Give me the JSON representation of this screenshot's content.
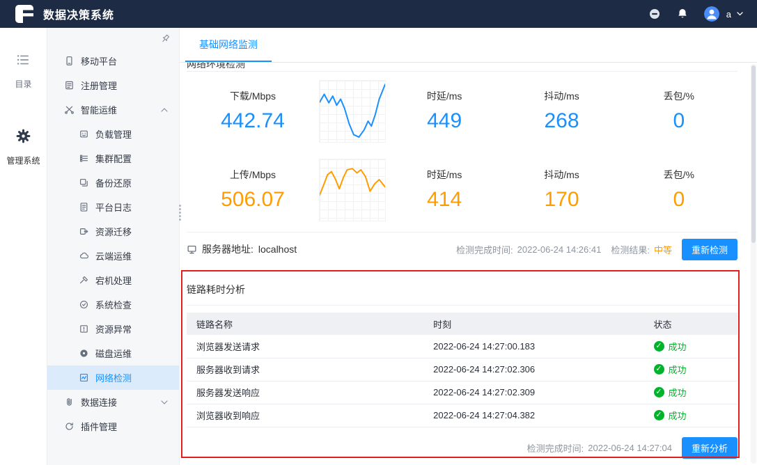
{
  "topbar": {
    "title": "数据决策系统",
    "username": "a"
  },
  "rail": {
    "catalog_label": "目录",
    "admin_label": "管理系统"
  },
  "sidebar": {
    "items": [
      {
        "label": "移动平台"
      },
      {
        "label": "注册管理"
      },
      {
        "label": "智能运维"
      },
      {
        "label": "负载管理"
      },
      {
        "label": "集群配置"
      },
      {
        "label": "备份还原"
      },
      {
        "label": "平台日志"
      },
      {
        "label": "资源迁移"
      },
      {
        "label": "云端运维"
      },
      {
        "label": "宕机处理"
      },
      {
        "label": "系统检查"
      },
      {
        "label": "资源异常"
      },
      {
        "label": "磁盘运维"
      },
      {
        "label": "网络检测"
      },
      {
        "label": "数据连接"
      },
      {
        "label": "插件管理"
      }
    ]
  },
  "tab": {
    "label": "基础网络监测"
  },
  "network": {
    "section_title": "网络环境检测",
    "download": {
      "label": "下载/Mbps",
      "value": "442.74",
      "delay_label": "时延/ms",
      "delay": "449",
      "jitter_label": "抖动/ms",
      "jitter": "268",
      "loss_label": "丢包/%",
      "loss": "0"
    },
    "upload": {
      "label": "上传/Mbps",
      "value": "506.07",
      "delay_label": "时延/ms",
      "delay": "414",
      "jitter_label": "抖动/ms",
      "jitter": "170",
      "loss_label": "丢包/%",
      "loss": "0"
    },
    "server_label": "服务器地址:",
    "server_value": "localhost",
    "finish_label": "检测完成时间:",
    "finish_time": "2022-06-24 14:26:41",
    "result_label": "检测结果:",
    "result_value": "中等",
    "redetect": "重新检测"
  },
  "chart_data": [
    {
      "type": "line",
      "name": "download-trend",
      "color": "#1890ff",
      "x_range": [
        0,
        100
      ],
      "y_range": [
        0,
        100
      ],
      "points": [
        [
          0,
          35
        ],
        [
          7,
          22
        ],
        [
          14,
          36
        ],
        [
          20,
          25
        ],
        [
          26,
          40
        ],
        [
          32,
          30
        ],
        [
          38,
          45
        ],
        [
          45,
          70
        ],
        [
          52,
          88
        ],
        [
          60,
          92
        ],
        [
          68,
          80
        ],
        [
          74,
          66
        ],
        [
          79,
          74
        ],
        [
          85,
          55
        ],
        [
          91,
          30
        ],
        [
          100,
          6
        ]
      ]
    },
    {
      "type": "line",
      "name": "upload-trend",
      "color": "#ff9c00",
      "x_range": [
        0,
        100
      ],
      "y_range": [
        0,
        100
      ],
      "points": [
        [
          0,
          58
        ],
        [
          6,
          42
        ],
        [
          12,
          25
        ],
        [
          18,
          20
        ],
        [
          24,
          32
        ],
        [
          30,
          48
        ],
        [
          36,
          30
        ],
        [
          42,
          17
        ],
        [
          50,
          15
        ],
        [
          57,
          22
        ],
        [
          63,
          17
        ],
        [
          70,
          28
        ],
        [
          77,
          52
        ],
        [
          84,
          40
        ],
        [
          91,
          33
        ],
        [
          100,
          45
        ]
      ]
    }
  ],
  "links": {
    "title": "链路耗时分析",
    "headers": [
      "链路名称",
      "时刻",
      "状态"
    ],
    "rows": [
      {
        "name": "浏览器发送请求",
        "time": "2022-06-24 14:27:00.183",
        "status": "成功"
      },
      {
        "name": "服务器收到请求",
        "time": "2022-06-24 14:27:02.306",
        "status": "成功"
      },
      {
        "name": "服务器发送响应",
        "time": "2022-06-24 14:27:02.309",
        "status": "成功"
      },
      {
        "name": "浏览器收到响应",
        "time": "2022-06-24 14:27:04.382",
        "status": "成功"
      }
    ],
    "finish_label": "检测完成时间:",
    "finish_time": "2022-06-24 14:27:04",
    "reanalyze": "重新分析"
  },
  "colors": {
    "accent": "#1890ff",
    "orange": "#ff9c00",
    "success": "#00b42a",
    "topbar": "#1e2b45",
    "annotation": "#e11d1d"
  },
  "check_glyph": "✓"
}
